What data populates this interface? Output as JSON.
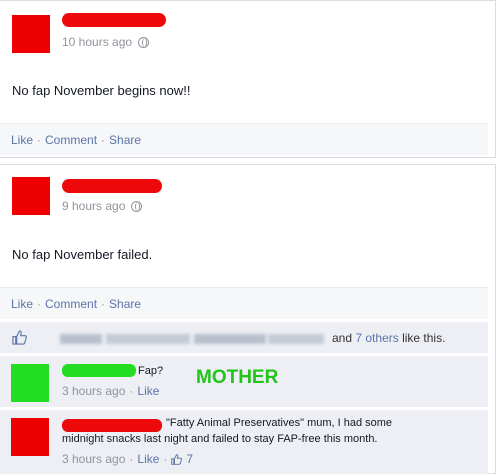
{
  "post1": {
    "timestamp": "10 hours ago",
    "status": "No fap November begins now!!",
    "actions": {
      "like": "Like",
      "comment": "Comment",
      "share": "Share"
    }
  },
  "post2": {
    "timestamp": "9 hours ago",
    "status": "No fap November failed.",
    "actions": {
      "like": "Like",
      "comment": "Comment",
      "share": "Share"
    },
    "likes": {
      "and": "and",
      "others_link": "7 others",
      "suffix": "like this."
    },
    "comments": [
      {
        "text": "Fap?",
        "time": "3 hours ago",
        "like": "Like",
        "annotation": "MOTHER"
      },
      {
        "text_line1": "\"Fatty Animal Preservatives\" mum, I had some",
        "text_line2": "midnight snacks last night and failed to stay FAP-free this month.",
        "time": "3 hours ago",
        "like": "Like",
        "like_count": "7"
      }
    ]
  },
  "colors": {
    "redaction_red": "#ee0000",
    "redaction_green": "#22dd22",
    "mother_label": "#22c41a",
    "link_blue": "#5b74a8"
  }
}
